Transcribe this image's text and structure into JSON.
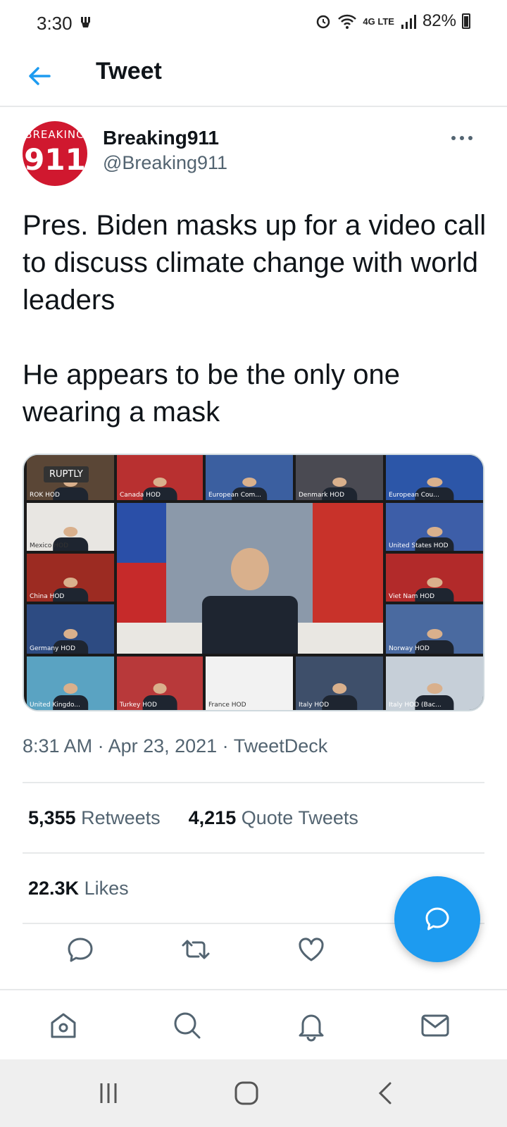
{
  "status_bar": {
    "time": "3:30",
    "network": "4G LTE",
    "battery": "82%"
  },
  "header": {
    "title": "Tweet"
  },
  "author": {
    "name": "Breaking911",
    "handle": "@Breaking911",
    "avatar_text_top": "BREAKING",
    "avatar_text_num": "911"
  },
  "tweet": {
    "text": "Pres. Biden masks up for a video call to discuss climate change with world leaders\n\nHe appears to be the only one wearing a mask",
    "timestamp": "8:31 AM · Apr 23, 2021 · TweetDeck"
  },
  "media": {
    "watermark": "RUPTLY",
    "tiles": [
      "ROK HOD",
      "Canada HOD",
      "European Com...",
      "Denmark HOD",
      "European Cou...",
      "Mexico HOD",
      "United States HOD",
      "China HOD",
      "Viet Nam HOD",
      "Germany HOD",
      "Norway HOD",
      "United Kingdo...",
      "Turkey HOD",
      "France HOD",
      "Italy HOD",
      "Italy HOD (Bac..."
    ]
  },
  "stats": {
    "retweets_count": "5,355",
    "retweets_label": "Retweets",
    "quotes_count": "4,215",
    "quotes_label": "Quote Tweets",
    "likes_count": "22.3K",
    "likes_label": "Likes"
  },
  "colors": {
    "accent": "#1d9bf0",
    "text": "#0f1419",
    "secondary": "#536471",
    "avatar_bg": "#d0182f"
  }
}
